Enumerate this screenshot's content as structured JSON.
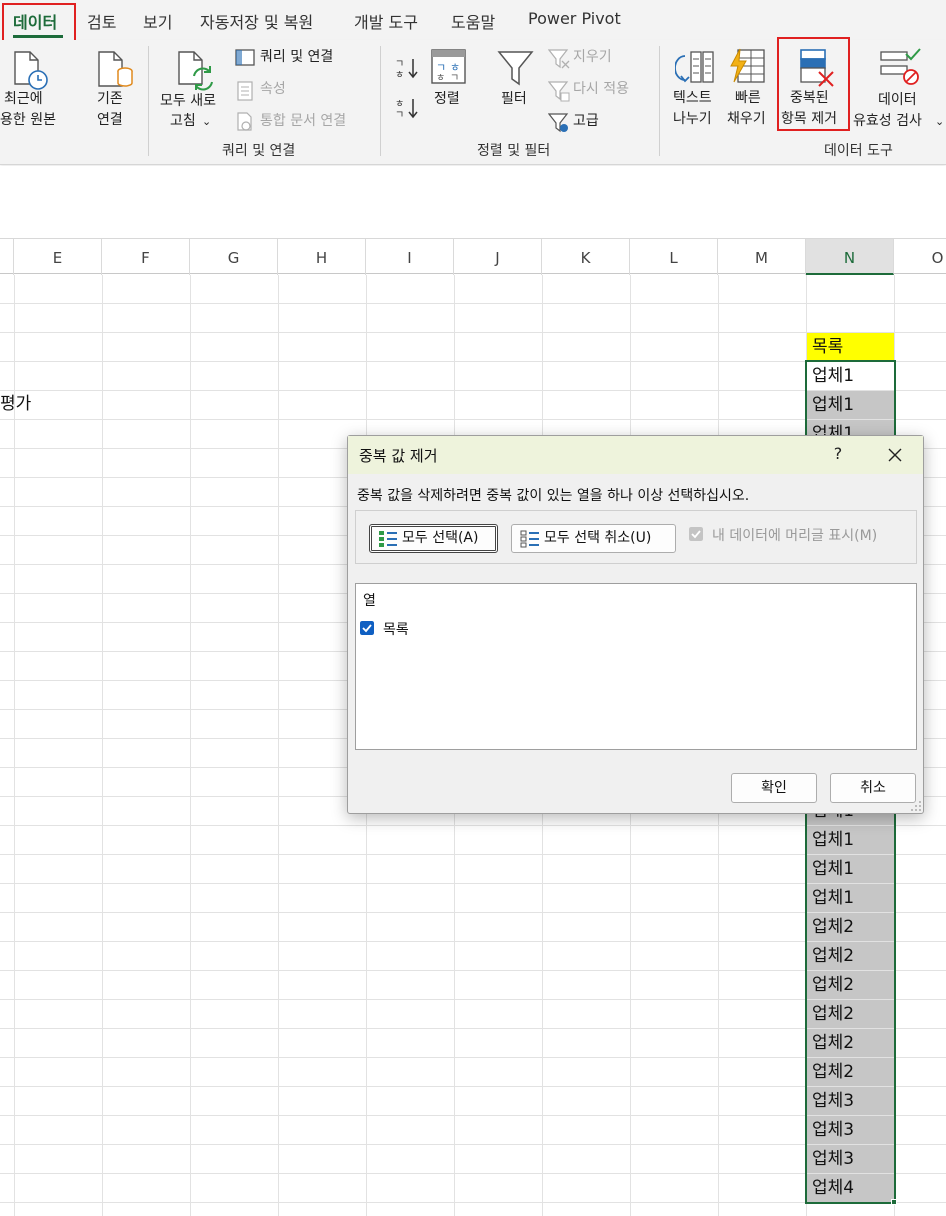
{
  "tabs": [
    {
      "label": "데이터",
      "active": true
    },
    {
      "label": "검토"
    },
    {
      "label": "보기"
    },
    {
      "label": "자동저장 및 복원"
    },
    {
      "label": "개발 도구"
    },
    {
      "label": "도움말"
    },
    {
      "label": "Power Pivot"
    }
  ],
  "ribbon": {
    "recent_sources": {
      "line1": "최근에",
      "line2": "용한 원본"
    },
    "existing_connections": {
      "line1": "기존",
      "line2": "연결"
    },
    "refresh_all": {
      "line1": "모두 새로",
      "line2": "고침"
    },
    "queries_connections": "쿼리 및 연결",
    "properties": "속성",
    "edit_links": "통합 문서 연결",
    "group_queries": "쿼리 및 연결",
    "sort": "정렬",
    "filter": "필터",
    "clear": "지우기",
    "reapply": "다시 적용",
    "advanced": "고급",
    "group_sort_filter": "정렬 및 필터",
    "text_to_columns": {
      "line1": "텍스트",
      "line2": "나누기"
    },
    "flash_fill": {
      "line1": "빠른",
      "line2": "채우기"
    },
    "remove_duplicates": {
      "line1": "중복된",
      "line2": "항목 제거"
    },
    "data_validation": {
      "line1": "데이터",
      "line2": "유효성 검사"
    },
    "group_data_tools": "데이터 도구"
  },
  "columns": [
    "E",
    "F",
    "G",
    "H",
    "I",
    "J",
    "K",
    "L",
    "M",
    "N",
    "O"
  ],
  "selected_column": "N",
  "cells": {
    "d_row4_partial": "평가",
    "n_header": "목록",
    "n_top_values": [
      "업체1",
      "업체1",
      "업체1"
    ],
    "n_bottom_values": [
      "업체1",
      "업체1",
      "업체1",
      "업체1",
      "업체2",
      "업체2",
      "업체2",
      "업체2",
      "업체2",
      "업체2",
      "업체3",
      "업체3",
      "업체3",
      "업체4"
    ]
  },
  "dialog": {
    "title": "중복 값 제거",
    "help": "?",
    "message": "중복 값을 삭제하려면 중복 값이 있는 열을 하나 이상 선택하십시오.",
    "select_all": "모두 선택(A)",
    "unselect_all": "모두 선택 취소(U)",
    "header_checkbox": "내 데이터에 머리글 표시(M)",
    "header_checkbox_checked": true,
    "header_checkbox_enabled": false,
    "list_header": "열",
    "columns_list": [
      {
        "label": "목록",
        "checked": true
      }
    ],
    "ok": "확인",
    "cancel": "취소"
  },
  "colors": {
    "excel_green": "#1d6b3a",
    "highlight_red": "#e02020",
    "header_yellow": "#ffff00",
    "checkbox_blue": "#0f5fc2"
  }
}
